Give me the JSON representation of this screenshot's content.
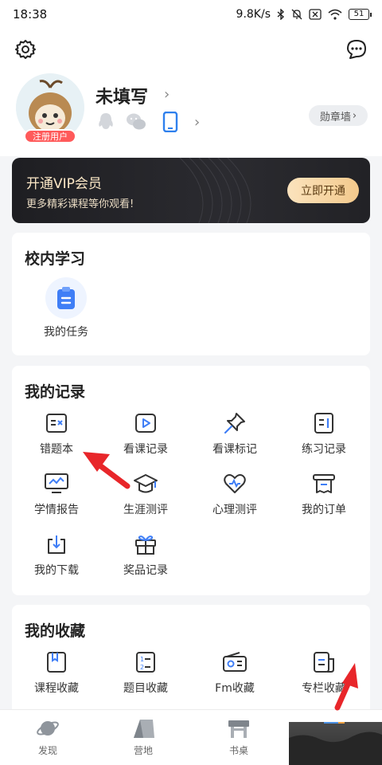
{
  "status": {
    "time": "18:38",
    "speed": "9.8K/s",
    "battery": "51"
  },
  "profile": {
    "name": "未填写",
    "badge": "注册用户",
    "medal_wall": "勋章墙"
  },
  "vip": {
    "title": "开通VIP会员",
    "subtitle": "更多精彩课程等你观看!",
    "button": "立即开通"
  },
  "school": {
    "title": "校内学习",
    "items": [
      {
        "label": "我的任务",
        "icon": "clipboard-icon"
      }
    ]
  },
  "records": {
    "title": "我的记录",
    "items": [
      {
        "label": "错题本",
        "icon": "wrong-book-icon"
      },
      {
        "label": "看课记录",
        "icon": "play-video-icon"
      },
      {
        "label": "看课标记",
        "icon": "pin-icon"
      },
      {
        "label": "练习记录",
        "icon": "practice-icon"
      },
      {
        "label": "学情报告",
        "icon": "monitor-chart-icon"
      },
      {
        "label": "生涯测评",
        "icon": "graduation-cap-icon"
      },
      {
        "label": "心理测评",
        "icon": "heart-pulse-icon"
      },
      {
        "label": "我的订单",
        "icon": "receipt-icon"
      },
      {
        "label": "我的下载",
        "icon": "download-icon"
      },
      {
        "label": "奖品记录",
        "icon": "gift-icon"
      }
    ]
  },
  "favorites": {
    "title": "我的收藏",
    "items": [
      {
        "label": "课程收藏",
        "icon": "bookmark-book-icon"
      },
      {
        "label": "题目收藏",
        "icon": "numbered-list-icon"
      },
      {
        "label": "Fm收藏",
        "icon": "radio-icon"
      },
      {
        "label": "专栏收藏",
        "icon": "document-icon"
      }
    ]
  },
  "tabs": [
    {
      "label": "发现",
      "icon": "planet-icon"
    },
    {
      "label": "营地",
      "icon": "tent-icon"
    },
    {
      "label": "书桌",
      "icon": "desk-icon"
    },
    {
      "label": "",
      "icon": "profile-tab-icon"
    }
  ],
  "colors": {
    "accent": "#3b82f6",
    "badge": "#ff5a5a",
    "arrow": "#e8262a"
  }
}
